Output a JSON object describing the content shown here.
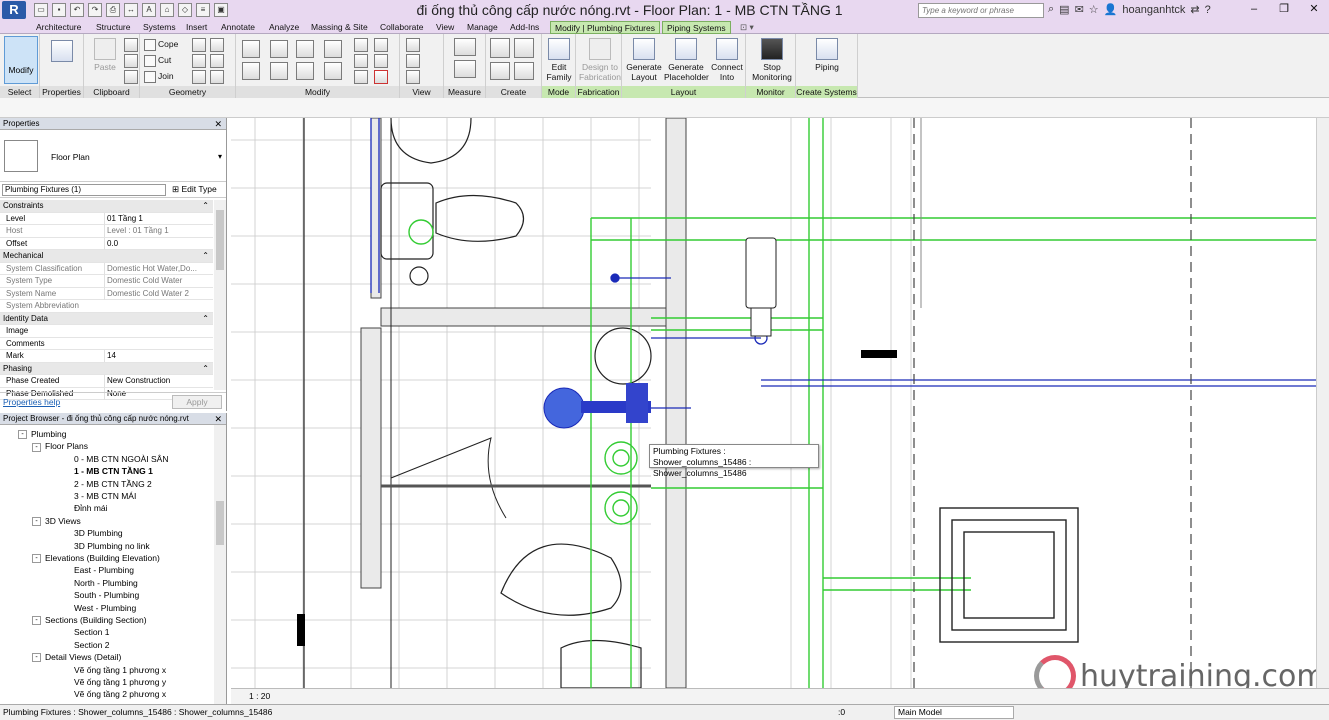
{
  "app": {
    "logo": "R",
    "title": "đi ống thủ công cấp nước nóng.rvt - Floor Plan: 1 - MB CTN TẦNG 1"
  },
  "search": {
    "placeholder": "Type a keyword or phrase"
  },
  "user": {
    "name": "hoanganhtck"
  },
  "tabs": [
    "Architecture",
    "Structure",
    "Systems",
    "Insert",
    "Annotate",
    "Analyze",
    "Massing & Site",
    "Collaborate",
    "View",
    "Manage",
    "Add-Ins",
    "Modify | Plumbing Fixtures",
    "Piping Systems"
  ],
  "ribbon": {
    "modify": "Modify",
    "select": "Select",
    "properties": "Properties",
    "paste": "Paste",
    "clipboard": "Clipboard",
    "cope": "Cope",
    "cut": "Cut",
    "join": "Join",
    "geometry": "Geometry",
    "modify_group": "Modify",
    "view": "View",
    "measure": "Measure",
    "create": "Create",
    "edit_family": "Edit Family",
    "mode": "Mode",
    "design_to_fabrication": "Design to Fabrication",
    "fabrication": "Fabrication",
    "generate_layout": "Generate Layout",
    "generate_placeholder": "Generate Placeholder",
    "connect_into": "Connect Into",
    "layout": "Layout",
    "stop_monitoring": "Stop Monitoring",
    "monitor": "Monitor",
    "piping": "Piping",
    "create_systems": "Create Systems"
  },
  "properties": {
    "header": "Properties",
    "type_name": "Floor Plan",
    "filter": "Plumbing Fixtures (1)",
    "edit_type": "Edit Type",
    "rows": [
      {
        "group": "Constraints"
      },
      {
        "k": "Level",
        "v": "01 Tầng 1"
      },
      {
        "k": "Host",
        "v": "Level : 01 Tầng 1",
        "gray": true
      },
      {
        "k": "Offset",
        "v": "0.0"
      },
      {
        "group": "Mechanical"
      },
      {
        "k": "System Classification",
        "v": "Domestic Hot Water,Do...",
        "gray": true
      },
      {
        "k": "System Type",
        "v": "Domestic Cold Water",
        "gray": true
      },
      {
        "k": "System Name",
        "v": "Domestic Cold Water 2",
        "gray": true
      },
      {
        "k": "System Abbreviation",
        "v": "",
        "gray": true
      },
      {
        "group": "Identity Data"
      },
      {
        "k": "Image",
        "v": ""
      },
      {
        "k": "Comments",
        "v": ""
      },
      {
        "k": "Mark",
        "v": "14"
      },
      {
        "group": "Phasing"
      },
      {
        "k": "Phase Created",
        "v": "New Construction"
      },
      {
        "k": "Phase Demolished",
        "v": "None"
      }
    ],
    "help": "Properties help",
    "apply": "Apply"
  },
  "browser": {
    "header": "Project Browser - đi ống thủ công cấp nước nóng.rvt",
    "nodes": [
      {
        "t": "Plumbing",
        "lvl": 2,
        "tog": "-"
      },
      {
        "t": "Floor Plans",
        "lvl": 3,
        "tog": "-"
      },
      {
        "t": "0 - MB CTN NGOÀI SÂN",
        "lvl": 4
      },
      {
        "t": "1 - MB CTN TẦNG 1",
        "lvl": 4,
        "bold": true
      },
      {
        "t": "2 - MB CTN TẦNG 2",
        "lvl": 4
      },
      {
        "t": "3 -  MB CTN MÁI",
        "lvl": 4
      },
      {
        "t": "Đỉnh mái",
        "lvl": 4
      },
      {
        "t": "3D Views",
        "lvl": 3,
        "tog": "-"
      },
      {
        "t": "3D Plumbing",
        "lvl": 4
      },
      {
        "t": "3D Plumbing no link",
        "lvl": 4
      },
      {
        "t": "Elevations (Building Elevation)",
        "lvl": 3,
        "tog": "-"
      },
      {
        "t": "East - Plumbing",
        "lvl": 4
      },
      {
        "t": "North - Plumbing",
        "lvl": 4
      },
      {
        "t": "South - Plumbing",
        "lvl": 4
      },
      {
        "t": "West - Plumbing",
        "lvl": 4
      },
      {
        "t": "Sections (Building Section)",
        "lvl": 3,
        "tog": "-"
      },
      {
        "t": "Section 1",
        "lvl": 4
      },
      {
        "t": "Section 2",
        "lvl": 4
      },
      {
        "t": "Detail Views (Detail)",
        "lvl": 3,
        "tog": "-"
      },
      {
        "t": "Vẽ ống tầng 1 phương x",
        "lvl": 4
      },
      {
        "t": "Vẽ ống tầng 1 phương y",
        "lvl": 4
      },
      {
        "t": "Vẽ ống tầng 2 phương x",
        "lvl": 4
      }
    ]
  },
  "tooltip": {
    "line1": "Plumbing Fixtures : Shower_columns_15486 :",
    "line2": "Shower_columns_15486"
  },
  "view": {
    "scale": "1 : 20"
  },
  "status": {
    "text": "Plumbing Fixtures : Shower_columns_15486 : Shower_columns_15486",
    "zero": ":0",
    "model": "Main Model"
  },
  "watermark": {
    "text": "huytraining.com"
  },
  "colors": {
    "accent": "#2a5aa8",
    "context_tab": "#c7e8b0",
    "pipe_green": "#33cc33",
    "pipe_blue": "#1a2ab8"
  }
}
